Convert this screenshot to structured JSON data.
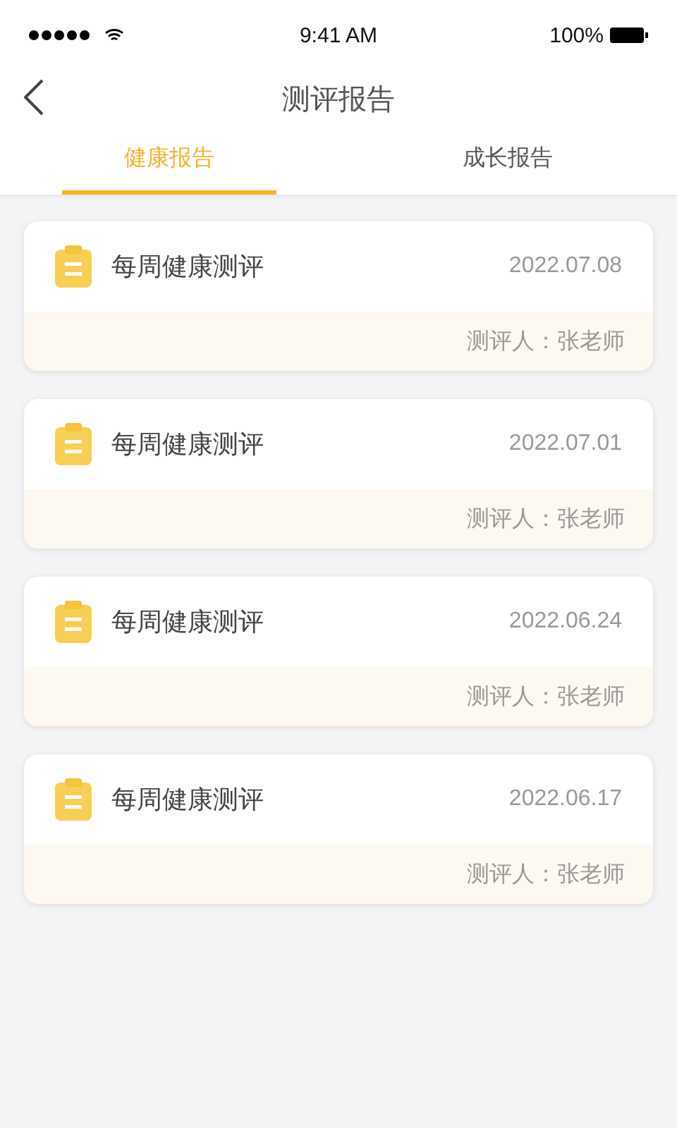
{
  "status_bar": {
    "time": "9:41 AM",
    "battery": "100%"
  },
  "header": {
    "title": "测评报告"
  },
  "tabs": [
    {
      "label": "健康报告",
      "selected": true
    },
    {
      "label": "成长报告",
      "selected": false
    }
  ],
  "reports": [
    {
      "title": "每周健康测评",
      "date": "2022.07.08",
      "assessor": "测评人：张老师"
    },
    {
      "title": "每周健康测评",
      "date": "2022.07.01",
      "assessor": "测评人：张老师"
    },
    {
      "title": "每周健康测评",
      "date": "2022.06.24",
      "assessor": "测评人：张老师"
    },
    {
      "title": "每周健康测评",
      "date": "2022.06.17",
      "assessor": "测评人：张老师"
    }
  ]
}
